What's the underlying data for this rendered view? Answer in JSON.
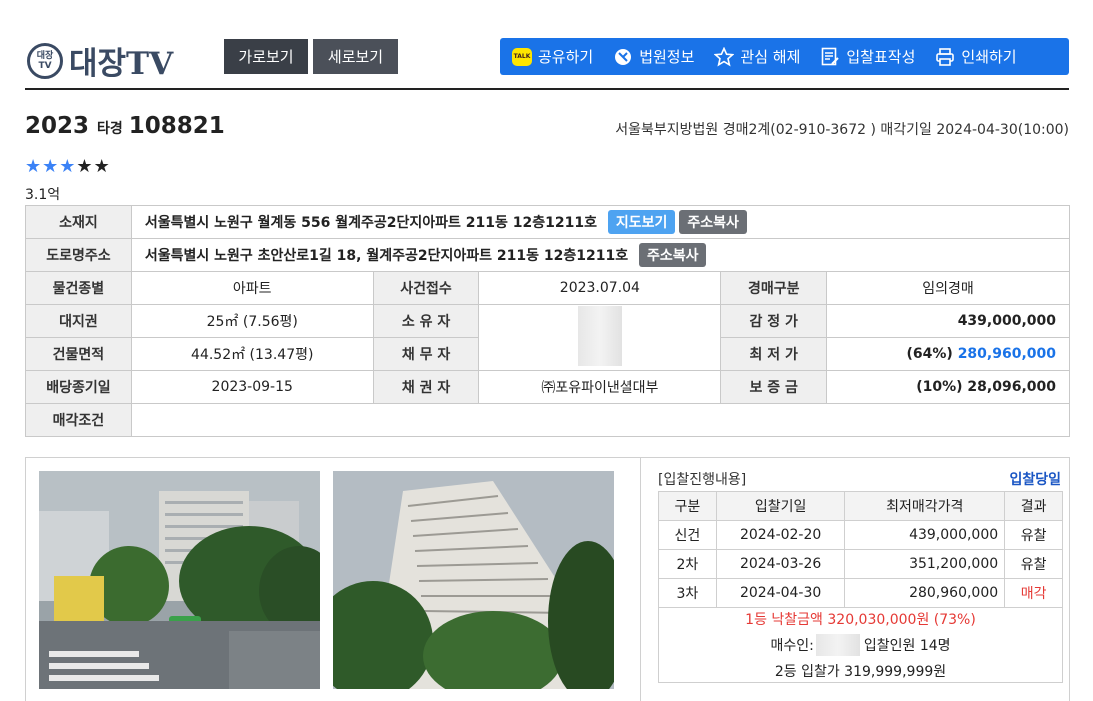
{
  "header": {
    "logo_badge_top": "대장",
    "logo_badge_bottom": "TV",
    "logo_text": "대장TV",
    "view_horizontal": "가로보기",
    "view_vertical": "세로보기",
    "tools": {
      "share": "공유하기",
      "court_info": "법원정보",
      "unfavorite": "관심 해제",
      "bid_form": "입찰표작성",
      "print": "인쇄하기"
    }
  },
  "case": {
    "year": "2023",
    "type": "타경",
    "number": "108821",
    "court_info": "서울북부지방법원 경매2계(02-910-3672 ) 매각기일 2024-04-30(10:00)"
  },
  "rating": {
    "filled": 3,
    "total": 5,
    "value_text": "3.1억"
  },
  "info": {
    "location_label": "소재지",
    "location": "서울특별시 노원구 월계동 556 월계주공2단지아파트 211동 12층1211호",
    "map_btn": "지도보기",
    "copy_btn": "주소복사",
    "road_label": "도로명주소",
    "road_address": "서울특별시 노원구 초안산로1길 18, 월계주공2단지아파트 211동 12층1211호",
    "rows": [
      {
        "l1": "물건종별",
        "v1": "아파트",
        "l2": "사건접수",
        "v2": "2023.07.04",
        "l3": "경매구분",
        "v3": "임의경매"
      },
      {
        "l1": "대지권",
        "v1": "25㎡ (7.56평)",
        "l2": "소 유 자",
        "v2": "",
        "l3": "감 정 가",
        "v3": "439,000,000"
      },
      {
        "l1": "건물면적",
        "v1": "44.52㎡ (13.47평)",
        "l2": "채 무 자",
        "v2": "",
        "l3": "최 저 가",
        "v3_pct": "(64%)",
        "v3": "280,960,000"
      },
      {
        "l1": "배당종기일",
        "v1": "2023-09-15",
        "l2": "채 권 자",
        "v2": "㈜포유파이낸셜대부",
        "l3": "보 증 금",
        "v3_pct": "(10%)",
        "v3": "28,096,000"
      }
    ],
    "condition_label": "매각조건"
  },
  "bids": {
    "title": "[입찰진행내용]",
    "day_label": "입찰당일",
    "headers": [
      "구분",
      "입찰기일",
      "최저매각가격",
      "결과"
    ],
    "rows": [
      {
        "round": "신건",
        "date": "2024-02-20",
        "price": "439,000,000",
        "result": "유찰"
      },
      {
        "round": "2차",
        "date": "2024-03-26",
        "price": "351,200,000",
        "result": "유찰"
      },
      {
        "round": "3차",
        "date": "2024-04-30",
        "price": "280,960,000",
        "result": "매각"
      }
    ],
    "winning": "1등 낙찰금액 320,030,000원 (73%)",
    "buyer_label": "매수인:",
    "bidders": "입찰인원 14명",
    "second": "2등 입찰가 319,999,999원"
  },
  "colors": {
    "accent": "#1a73e8",
    "sold": "#e53935",
    "dark": "#3a3f47"
  }
}
